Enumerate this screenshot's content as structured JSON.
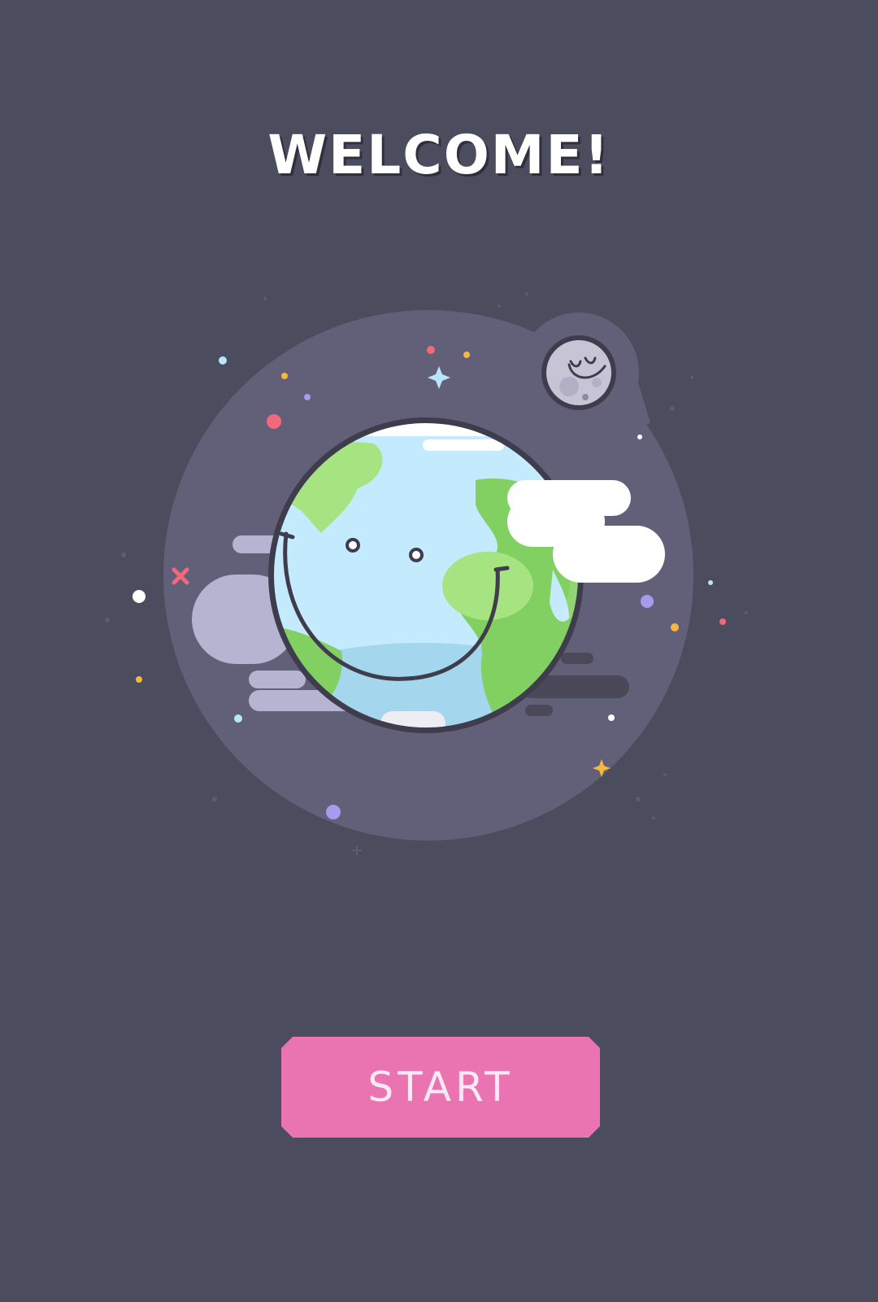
{
  "screen": {
    "title": "WELCOME!",
    "start_button_label": "START"
  },
  "colors": {
    "background": "#4c4c5f",
    "planet_backdrop": "#626079",
    "ocean": "#c4eafd",
    "ocean_shadow": "#a4d6ee",
    "land": "#82d062",
    "land_light": "#a6e482",
    "cloud": "#ffffff",
    "speed_lines": "#b5b4d1",
    "outline": "#3f3d4d",
    "moon": "#c7c4d6",
    "button": "#ea74b2",
    "button_text": "#fbe9f3"
  },
  "icons": {
    "earth": "smiling-earth-icon",
    "moon": "sleeping-moon-icon",
    "sparkle": "sparkle-icon",
    "cross_star": "cross-star-icon"
  }
}
